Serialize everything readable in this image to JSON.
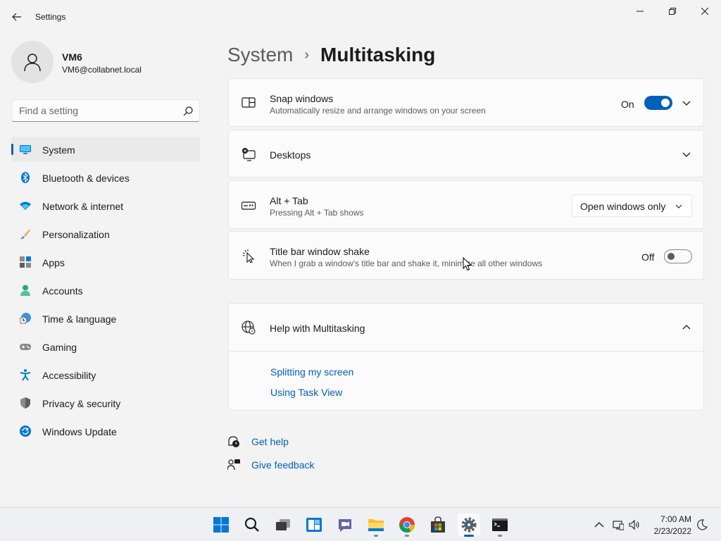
{
  "window": {
    "title": "Settings"
  },
  "profile": {
    "name": "VM6",
    "email": "VM6@collabnet.local"
  },
  "search": {
    "placeholder": "Find a setting"
  },
  "sidebar": {
    "items": [
      {
        "label": "System",
        "icon": "system-icon",
        "active": true
      },
      {
        "label": "Bluetooth & devices",
        "icon": "bluetooth-icon"
      },
      {
        "label": "Network & internet",
        "icon": "wifi-icon"
      },
      {
        "label": "Personalization",
        "icon": "brush-icon"
      },
      {
        "label": "Apps",
        "icon": "apps-icon"
      },
      {
        "label": "Accounts",
        "icon": "person-icon"
      },
      {
        "label": "Time & language",
        "icon": "clock-globe-icon"
      },
      {
        "label": "Gaming",
        "icon": "gamepad-icon"
      },
      {
        "label": "Accessibility",
        "icon": "accessibility-icon"
      },
      {
        "label": "Privacy & security",
        "icon": "shield-icon"
      },
      {
        "label": "Windows Update",
        "icon": "update-icon"
      }
    ]
  },
  "breadcrumb": {
    "parent": "System",
    "separator": "›",
    "current": "Multitasking"
  },
  "settings": {
    "snap": {
      "title": "Snap windows",
      "description": "Automatically resize and arrange windows on your screen",
      "state_label": "On",
      "enabled": true
    },
    "desktops": {
      "title": "Desktops"
    },
    "alt_tab": {
      "title": "Alt + Tab",
      "description": "Pressing Alt + Tab shows",
      "selected": "Open windows only"
    },
    "shake": {
      "title": "Title bar window shake",
      "description": "When I grab a window's title bar and shake it, minimize all other windows",
      "state_label": "Off",
      "enabled": false
    }
  },
  "help": {
    "title": "Help with Multitasking",
    "links": [
      "Splitting my screen",
      "Using Task View"
    ]
  },
  "footer": {
    "get_help": "Get help",
    "give_feedback": "Give feedback"
  },
  "taskbar": {
    "apps": [
      "start-icon",
      "search-icon",
      "task-view-icon",
      "widgets-icon",
      "chat-icon",
      "file-explorer-icon",
      "chrome-icon",
      "store-icon",
      "settings-icon",
      "terminal-icon"
    ],
    "active_app": "settings-icon",
    "time": "7:00 AM",
    "date": "2/23/2022"
  },
  "colors": {
    "accent": "#005fb8",
    "background": "#f3f3f3",
    "card": "#fbfbfb"
  }
}
